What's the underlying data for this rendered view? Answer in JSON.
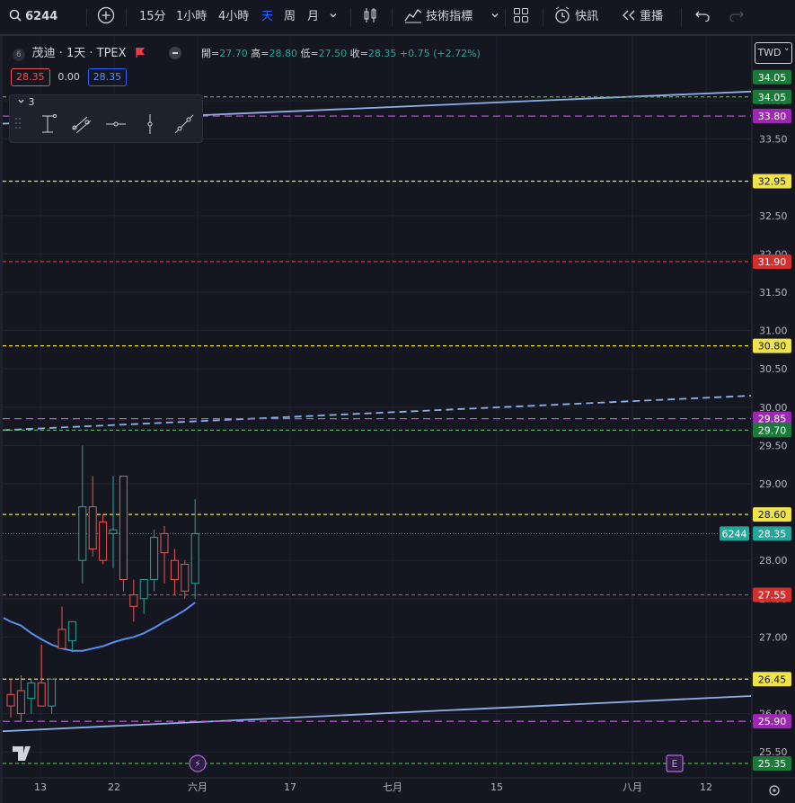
{
  "toolbar": {
    "symbol": "6244",
    "intervals": [
      "15分",
      "1小時",
      "4小時",
      "天",
      "周",
      "月"
    ],
    "active_interval": "天",
    "indicators_label": "技術指標",
    "alert_label": "快訊",
    "replay_label": "重播"
  },
  "legend": {
    "title_badge": "6",
    "symbol_name": "茂迪 · 1天 · TPEX",
    "open_label": "開",
    "open": "27.70",
    "high_label": "高",
    "high": "28.80",
    "low_label": "低",
    "low": "27.50",
    "close_label": "收",
    "close": "28.35",
    "change": "+0.75 (+2.72%)",
    "bid": "28.35",
    "spread": "0.00",
    "ask": "28.35"
  },
  "toolbox": {
    "count": "3"
  },
  "currency": "TWD",
  "colors": {
    "background": "#141720",
    "up": "#26a69a",
    "down": "#ef5350",
    "ma": "#5b8def",
    "trend": "#8fb1e8",
    "hline_green": "#4caf50",
    "hline_purple": "#c255d8",
    "hline_yellow": "#f1e34b",
    "hline_red": "#e03e3e"
  },
  "chart_data": {
    "type": "candlestick",
    "y_axis_ticks": [
      25.5,
      26.0,
      27.0,
      27.5,
      28.0,
      29.0,
      29.5,
      30.0,
      30.5,
      31.0,
      31.5,
      32.0,
      32.5,
      33.5,
      34.0
    ],
    "y_axis_tick_labels": [
      "25.50",
      "26.00",
      "27.00",
      "27.50",
      "28.00",
      "29.00",
      "29.50",
      "30.00",
      "30.50",
      "31.00",
      "31.50",
      "32.00",
      "32.50",
      "33.50",
      "34.00"
    ],
    "ylim": [
      25.2,
      34.6
    ],
    "x_axis_labels": [
      "13",
      "22",
      "六月",
      "17",
      "七月",
      "15",
      "八月",
      "12"
    ],
    "candles": [
      {
        "o": 26.25,
        "h": 26.45,
        "l": 25.95,
        "c": 26.1
      },
      {
        "o": 26.3,
        "h": 26.5,
        "l": 25.9,
        "c": 26.0
      },
      {
        "o": 26.2,
        "h": 26.45,
        "l": 26.0,
        "c": 26.4
      },
      {
        "o": 26.4,
        "h": 26.9,
        "l": 26.2,
        "c": 26.1
      },
      {
        "o": 26.1,
        "h": 26.4,
        "l": 26.0,
        "c": 26.45
      },
      {
        "o": 27.1,
        "h": 27.4,
        "l": 26.9,
        "c": 26.85
      },
      {
        "o": 26.95,
        "h": 27.2,
        "l": 26.8,
        "c": 27.2
      },
      {
        "o": 28.0,
        "h": 29.5,
        "l": 27.7,
        "c": 28.7
      },
      {
        "o": 28.7,
        "h": 29.1,
        "l": 28.05,
        "c": 28.15
      },
      {
        "o": 28.5,
        "h": 28.6,
        "l": 27.95,
        "c": 28.0
      },
      {
        "o": 28.35,
        "h": 29.1,
        "l": 27.9,
        "c": 28.4
      },
      {
        "o": 29.1,
        "h": 29.1,
        "l": 27.6,
        "c": 27.75
      },
      {
        "o": 27.55,
        "h": 27.75,
        "l": 27.2,
        "c": 27.4
      },
      {
        "o": 27.5,
        "h": 27.75,
        "l": 27.3,
        "c": 27.75
      },
      {
        "o": 27.75,
        "h": 28.4,
        "l": 27.6,
        "c": 28.3
      },
      {
        "o": 28.35,
        "h": 28.45,
        "l": 27.7,
        "c": 28.1
      },
      {
        "o": 28.0,
        "h": 28.15,
        "l": 27.55,
        "c": 27.75
      },
      {
        "o": 27.95,
        "h": 28.0,
        "l": 27.5,
        "c": 27.6
      },
      {
        "o": 27.7,
        "h": 28.8,
        "l": 27.5,
        "c": 28.35
      }
    ],
    "moving_average": [
      27.2,
      27.15,
      27.05,
      26.97,
      26.9,
      26.85,
      26.82,
      26.82,
      26.85,
      26.88,
      26.93,
      26.97,
      27.0,
      27.05,
      27.12,
      27.2,
      27.27,
      27.35,
      27.45
    ],
    "horizontal_levels": [
      {
        "value": 34.05,
        "label": "34.05",
        "color": "green"
      },
      {
        "value": 33.8,
        "label": "33.80",
        "color": "purple"
      },
      {
        "value": 32.95,
        "label": "32.95",
        "color": "yellow"
      },
      {
        "value": 31.9,
        "label": "31.90",
        "color": "red"
      },
      {
        "value": 30.8,
        "label": "30.80",
        "color": "yellow"
      },
      {
        "value": 29.85,
        "label": "29.85",
        "color": "purple"
      },
      {
        "value": 29.7,
        "label": "29.70",
        "color": "green"
      },
      {
        "value": 28.6,
        "label": "28.60",
        "color": "yellow"
      },
      {
        "value": 27.55,
        "label": "27.55",
        "color": "red"
      },
      {
        "value": 26.45,
        "label": "26.45",
        "color": "yellow"
      },
      {
        "value": 25.9,
        "label": "25.90",
        "color": "purple"
      },
      {
        "value": 25.35,
        "label": "25.35",
        "color": "green"
      }
    ],
    "extra_labels": [
      {
        "value": 34.05,
        "label": "34.05",
        "color": "green"
      }
    ],
    "last_price": {
      "value": 28.35,
      "label": "28.35",
      "symbol": "6244"
    },
    "trendlines": [
      {
        "y_left": 33.7,
        "y_right": 34.12,
        "style": "solid"
      },
      {
        "y_left": 29.7,
        "y_right": 30.15,
        "style": "dashed"
      },
      {
        "y_left": 25.77,
        "y_right": 26.23,
        "style": "solid"
      }
    ],
    "event_markers": [
      "⚡",
      "E"
    ]
  }
}
